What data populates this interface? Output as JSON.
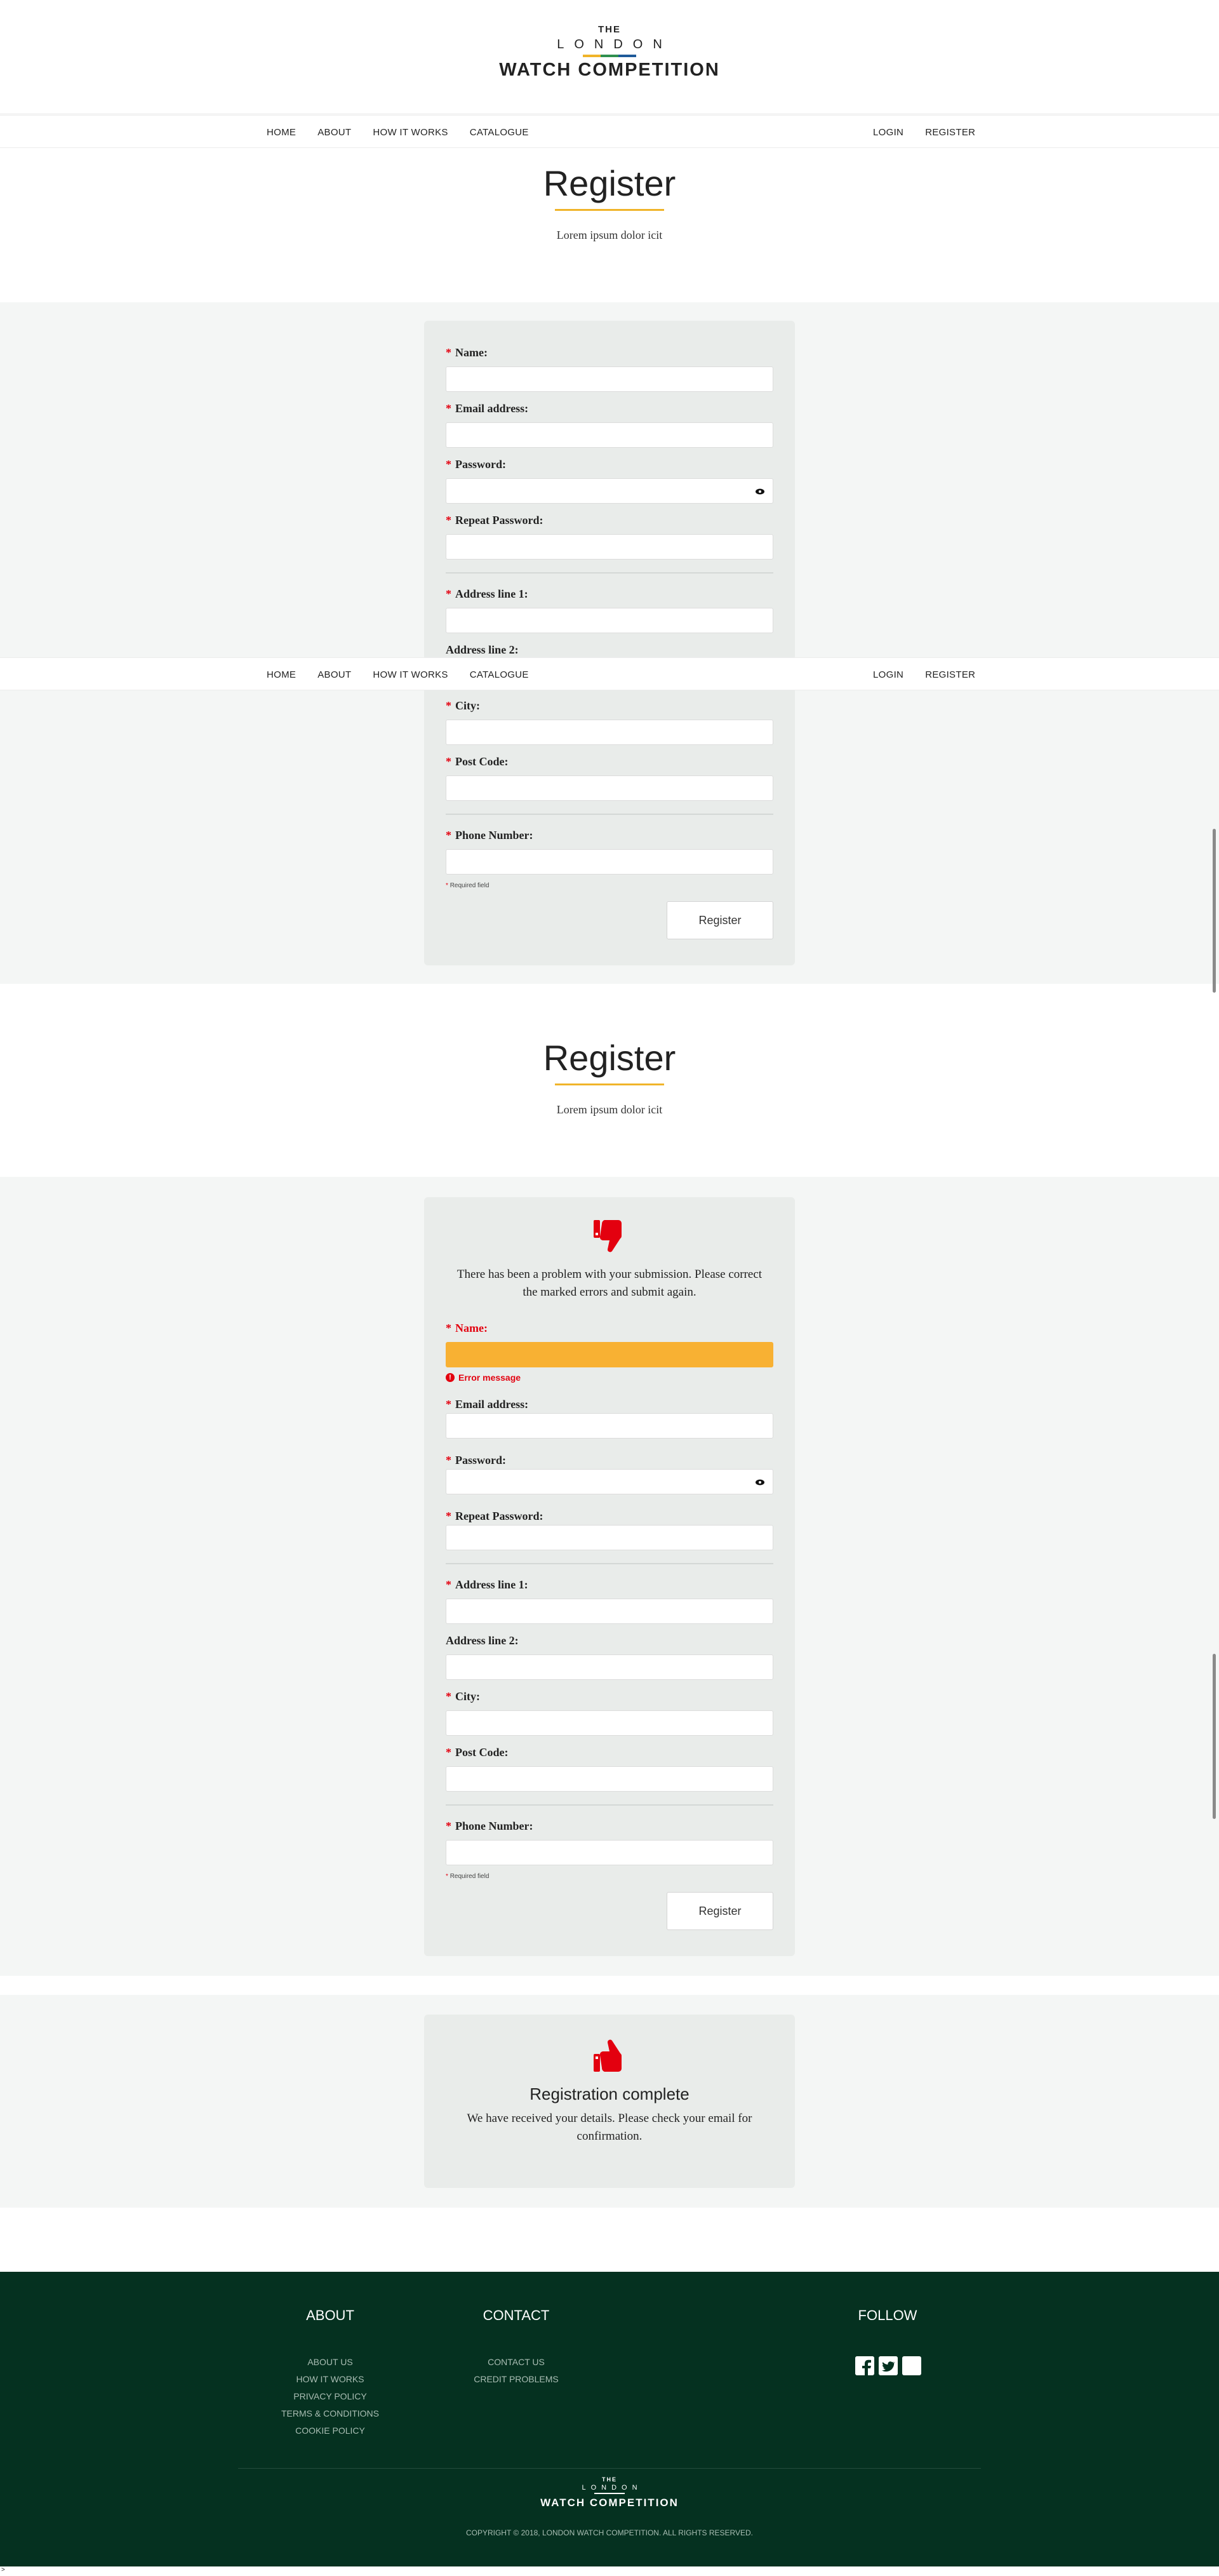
{
  "logo": {
    "the": "THE",
    "london": "LONDON",
    "watch": "WATCH COMPETITION",
    "stripe_colors": [
      "#f0b429",
      "#2f8f4e",
      "#1e5a99"
    ]
  },
  "nav": {
    "home": "HOME",
    "about": "ABOUT",
    "how": "HOW IT WORKS",
    "catalogue": "CATALOGUE",
    "login": "LOGIN",
    "register": "REGISTER"
  },
  "intro": {
    "title": "Register",
    "subtitle": "Lorem ipsum dolor icit"
  },
  "form": {
    "name": "Name:",
    "email": "Email address:",
    "password": "Password:",
    "repeat_password": "Repeat Password:",
    "address1": "Address line 1:",
    "address2": "Address line 2:",
    "city": "City:",
    "postcode": "Post Code:",
    "phone": "Phone Number:",
    "required_marker": "*",
    "required_note": "Required field",
    "submit": "Register"
  },
  "error_state": {
    "message": "There has been a problem with your submission. Please correct the marked errors and submit again.",
    "field_error": "Error message",
    "error_color": "#e3000f",
    "highlight_color": "#f8b133"
  },
  "success_state": {
    "title": "Registration complete",
    "message": "We have received your details. Please check your email for confirmation."
  },
  "footer": {
    "about_title": "ABOUT",
    "contact_title": "CONTACT",
    "follow_title": "FOLLOW",
    "about_links": [
      "ABOUT US",
      "HOW IT WORKS",
      "PRIVACY POLICY",
      "TERMS & CONDITIONS",
      "COOKIE POLICY"
    ],
    "contact_links": [
      "CONTACT US",
      "CREDIT PROBLEMS"
    ],
    "social_icons": [
      "facebook-icon",
      "twitter-icon",
      "instagram-icon"
    ],
    "copyright": "COPYRIGHT © 2018, LONDON WATCH COMPETITION. ALL RIGHTS RESERVED.",
    "bg_color": "#053120"
  },
  "bottom_mark": ">"
}
